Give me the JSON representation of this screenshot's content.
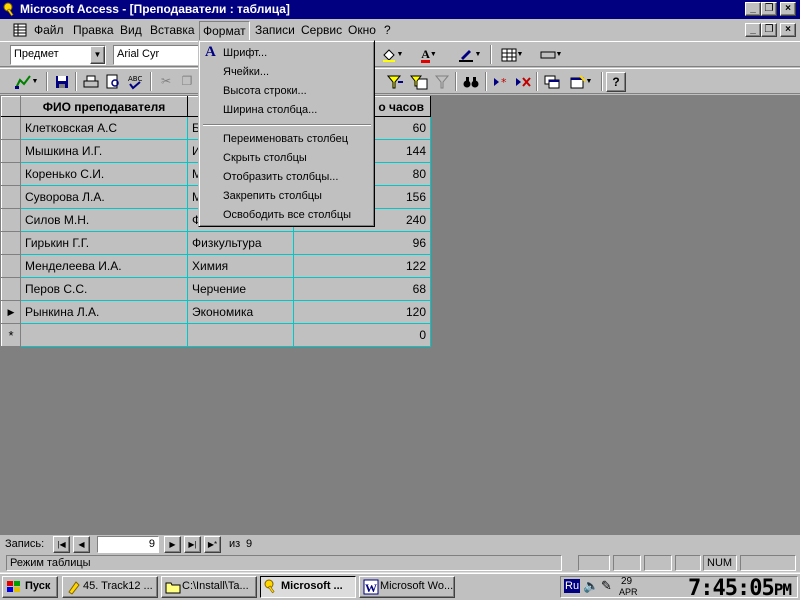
{
  "window": {
    "title": "Microsoft Access - [Преподаватели : таблица]"
  },
  "menubar": {
    "items": [
      "Файл",
      "Правка",
      "Вид",
      "Вставка",
      "Формат",
      "Записи",
      "Сервис",
      "Окно",
      "?"
    ],
    "open_menu": "Формат"
  },
  "toolbar_format": {
    "field_combo_value": "Предмет",
    "font_combo_value": "Arial Cyr"
  },
  "format_menu": {
    "items": [
      {
        "label": "Шрифт..."
      },
      {
        "label": "Ячейки..."
      },
      {
        "label": "Высота строки..."
      },
      {
        "label": "Ширина столбца..."
      },
      {
        "label": "Переименовать столбец"
      },
      {
        "label": "Скрыть столбцы"
      },
      {
        "label": "Отобразить столбцы..."
      },
      {
        "label": "Закрепить столбцы"
      },
      {
        "label": "Освободить все столбцы"
      }
    ]
  },
  "table": {
    "columns": [
      "ФИО преподавателя",
      "",
      "о часов"
    ],
    "rows": [
      [
        "Клетковская А.С",
        "Б",
        "60"
      ],
      [
        "Мышкина И.Г.",
        "И",
        "144"
      ],
      [
        "Коренько С.И.",
        "М",
        "80"
      ],
      [
        "Суворова Л.А.",
        "М",
        "156"
      ],
      [
        "Силов М.Н.",
        "Ф",
        "240"
      ],
      [
        "Гирькин Г.Г.",
        "Физкультура",
        "96"
      ],
      [
        "Менделеева И.А.",
        "Химия",
        "122"
      ],
      [
        "Перов С.С.",
        "Черчение",
        "68"
      ],
      [
        "Рынкина Л.А.",
        "Экономика",
        "120"
      ]
    ],
    "new_row": [
      "",
      "",
      "0"
    ],
    "current_row_marker": "▶",
    "new_row_marker": "*"
  },
  "record_nav": {
    "label": "Запись:",
    "current": "9",
    "of_label": "из",
    "total": "9"
  },
  "statusbar": {
    "mode": "Режим таблицы",
    "num": "NUM"
  },
  "taskbar": {
    "start": "Пуск",
    "buttons": [
      {
        "label": "45. Track12 ...",
        "icon": "music-icon"
      },
      {
        "label": "C:\\Install\\Ta...",
        "icon": "folder-icon"
      },
      {
        "label": "Microsoft ...",
        "icon": "access-key-icon"
      },
      {
        "label": "Microsoft Wo...",
        "icon": "word-icon"
      }
    ],
    "lang": "Ru",
    "date_day": "29",
    "date_month": "APR",
    "clock": "7:45:05",
    "clock_suffix": "PM"
  },
  "colors": {
    "title_bar": "#000080",
    "workspace": "#808080",
    "grid_lines": "#00c8c8"
  }
}
